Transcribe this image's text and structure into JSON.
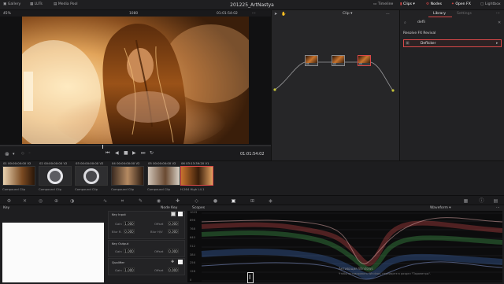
{
  "topbar": {
    "gallery": "Gallery",
    "luts": "LUTs",
    "media_pool": "Media Pool",
    "project_title": "201225_ArtNastya",
    "timeline": "Timeline",
    "clips": "Clips",
    "nodes": "Nodes",
    "open_fx": "Open FX",
    "lightbox": "Lightbox"
  },
  "viewer": {
    "zoom": "45%",
    "frame_number": "1080",
    "timecode_top": "01:01:54:02",
    "clip_mode": "Clip",
    "timecode_bottom": "01:01:54:02"
  },
  "nodes": [
    {
      "label": "01"
    },
    {
      "label": "02"
    },
    {
      "label": "03"
    }
  ],
  "library": {
    "tab_library": "Library",
    "tab_settings": "Settings",
    "search_value": "defli",
    "category": "Resolve FX Revival",
    "result": "Deflicker"
  },
  "clips": [
    {
      "index": "01",
      "timecode": "00:00:00:00",
      "track": "V2",
      "label": "Compound Clip"
    },
    {
      "index": "02",
      "timecode": "00:00:00:00",
      "track": "V2",
      "label": "Compound Clip"
    },
    {
      "index": "03",
      "timecode": "00:00:00:00",
      "track": "V2",
      "label": "Compound Clip"
    },
    {
      "index": "04",
      "timecode": "00:00:00:00",
      "track": "V2",
      "label": "Compound Clip"
    },
    {
      "index": "05",
      "timecode": "00:00:00:00",
      "track": "V2",
      "label": "Compound Clip"
    },
    {
      "index": "06",
      "timecode": "03:13:39:20",
      "track": "V1",
      "label": "H.264 High L4.1"
    }
  ],
  "key_panel": {
    "title": "Key",
    "node_key": "Node Key",
    "key_input": "Key Input",
    "gain_label": "Gain",
    "gain_value": "1.000",
    "offset_label": "Offset",
    "offset_value": "0.000",
    "blur_r_label": "Blur R.",
    "blur_r_value": "0.000",
    "blur_hv_label": "Blur H/V",
    "blur_hv_value": "0.000",
    "key_output": "Key Output",
    "out_gain_value": "1.000",
    "out_offset_value": "0.000",
    "qualifier": "Qualifier",
    "q_gain_value": "1.000",
    "q_offset_value": "0.000"
  },
  "scopes": {
    "title": "Scopes",
    "mode": "Waveform",
    "ticks": [
      "1023",
      "896",
      "768",
      "640",
      "512",
      "384",
      "256",
      "128",
      "0"
    ],
    "watermark_line1": "Активация Windows",
    "watermark_line2": "Чтобы активировать Windows, перейдите в раздел \"Параметры\"."
  },
  "colors": {
    "accent": "#d94848",
    "panel": "#262628",
    "background": "#1b1b1d"
  }
}
